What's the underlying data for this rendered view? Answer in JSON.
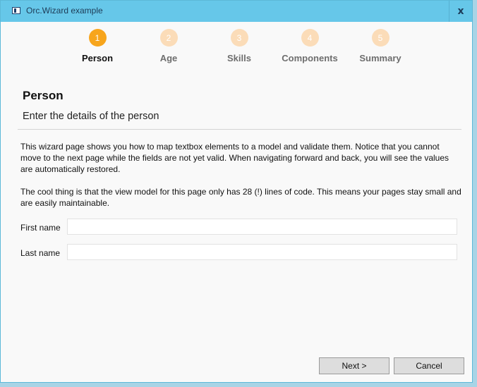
{
  "window": {
    "title": "Orc.Wizard example",
    "close_glyph": "x"
  },
  "steps": [
    {
      "number": "1",
      "label": "Person",
      "state": "active"
    },
    {
      "number": "2",
      "label": "Age",
      "state": "inactive"
    },
    {
      "number": "3",
      "label": "Skills",
      "state": "inactive"
    },
    {
      "number": "4",
      "label": "Components",
      "state": "inactive"
    },
    {
      "number": "5",
      "label": "Summary",
      "state": "inactive"
    }
  ],
  "colors": {
    "active_step": "#f7a51c",
    "inactive_step": "#fbdcb8",
    "active_label": "#111111",
    "inactive_label": "#6e6e6e",
    "titlebar": "#66c7e9"
  },
  "page": {
    "title": "Person",
    "subtitle": "Enter the details of the person",
    "description": [
      "This wizard page shows you how to map textbox elements to a model and validate them. Notice that you cannot move to the next page while the fields are not yet valid. When navigating forward and back, you will see the values are automatically restored.",
      "The cool thing is that the view model for this page only has 28 (!) lines of code. This means your pages stay small and are easily maintainable."
    ]
  },
  "fields": {
    "first_name": {
      "label": "First name",
      "value": ""
    },
    "last_name": {
      "label": "Last name",
      "value": ""
    }
  },
  "buttons": {
    "next": "Next >",
    "cancel": "Cancel"
  }
}
